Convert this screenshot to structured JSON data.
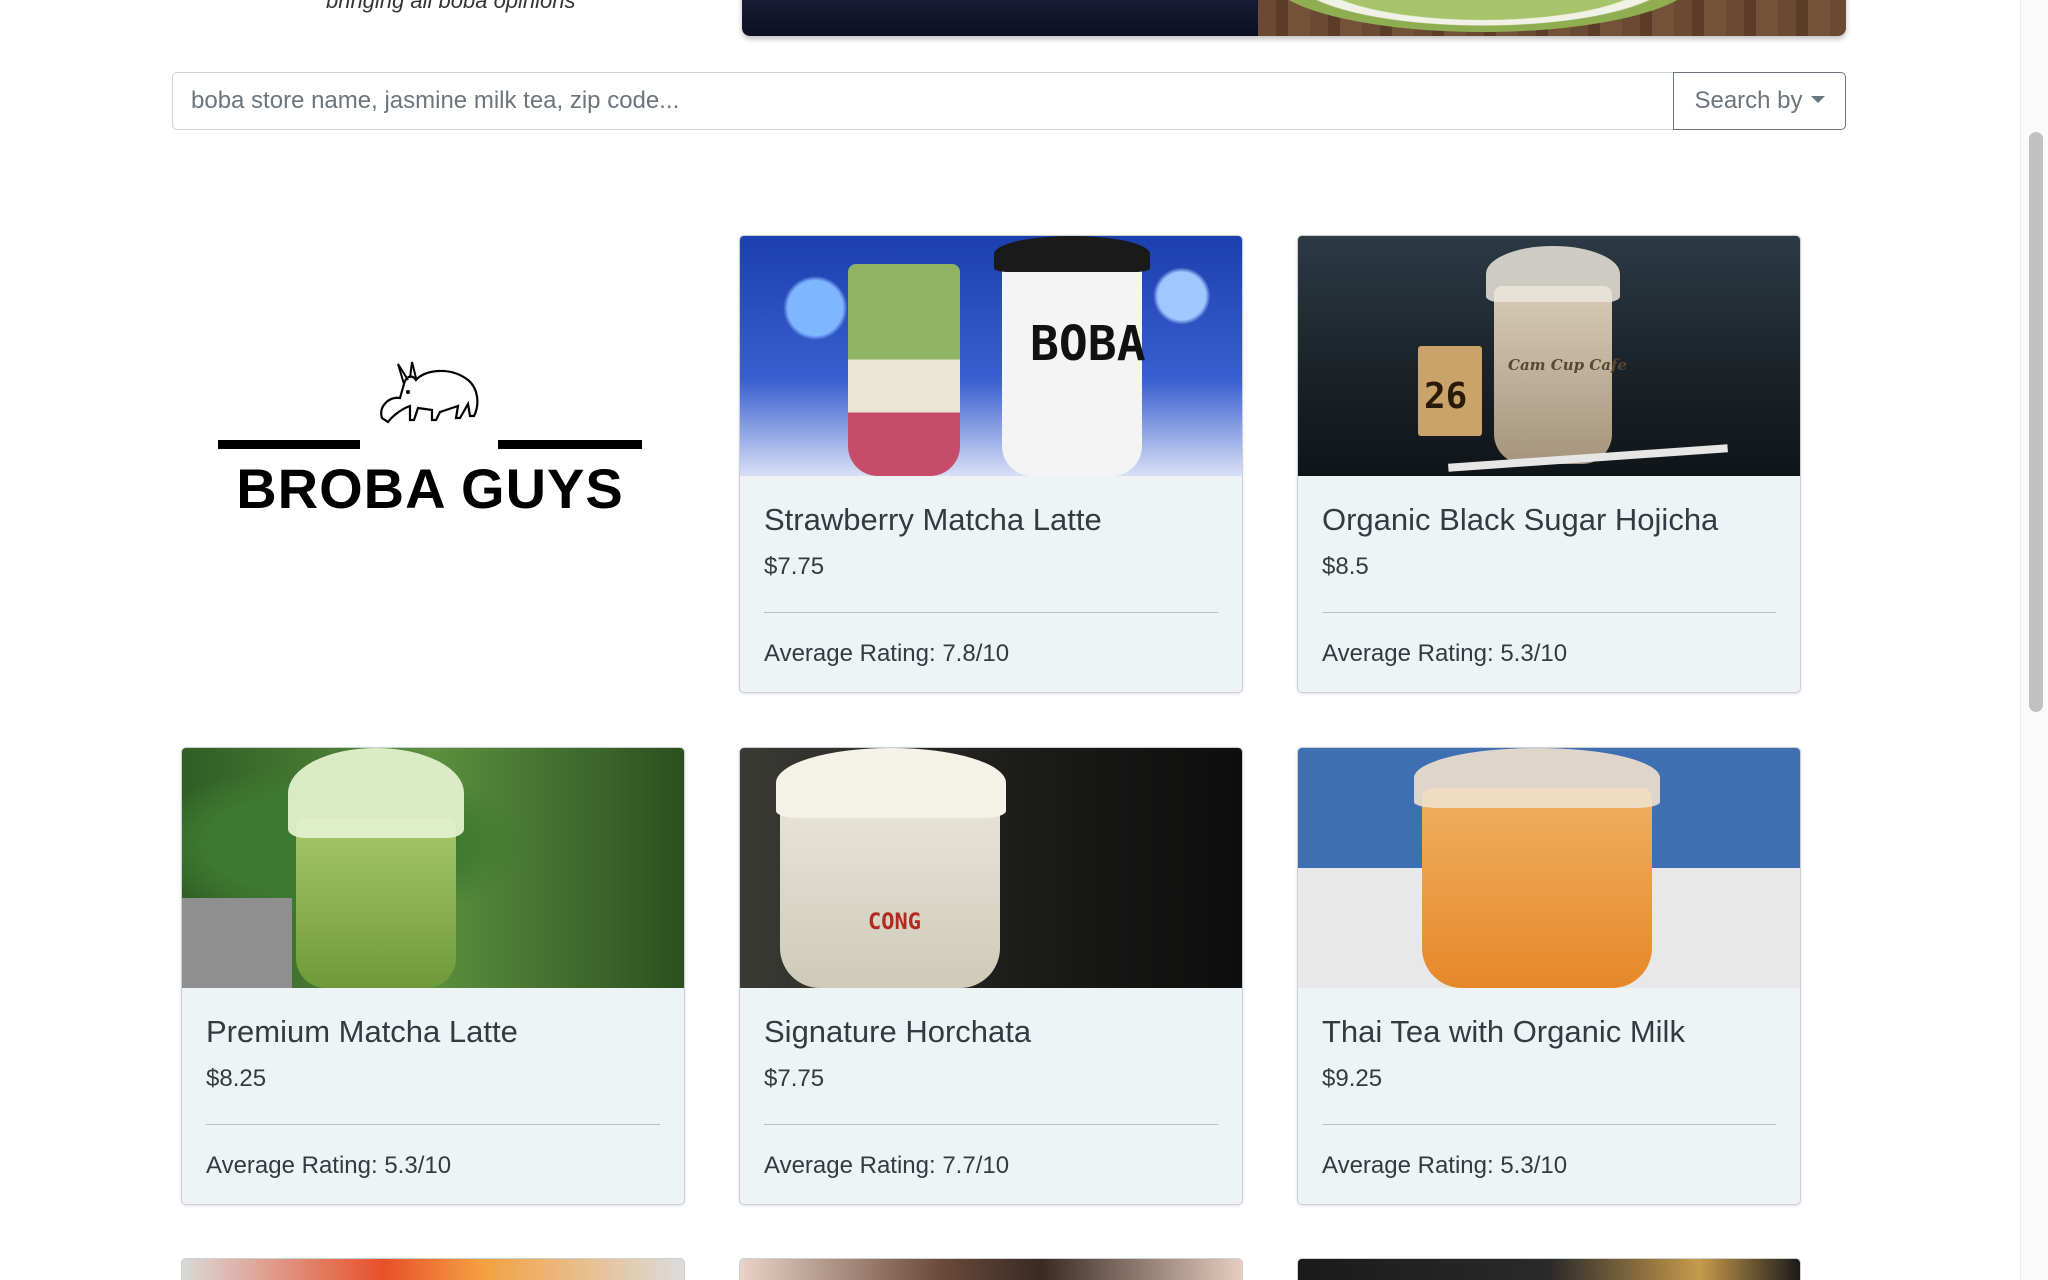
{
  "header": {
    "tagline": "bringing all boba opinions"
  },
  "search": {
    "placeholder": "boba store name, jasmine milk tea, zip code...",
    "button_label": "Search by"
  },
  "store": {
    "logo_text": "BROBA GUYS"
  },
  "drinks": [
    {
      "name": "Strawberry Matcha Latte",
      "price": "$7.75",
      "rating": "Average Rating: 7.8/10",
      "cup_text": "BOBA"
    },
    {
      "name": "Organic Black Sugar Hojicha",
      "price": "$8.5",
      "rating": "Average Rating: 5.3/10",
      "cup_text": "Cam Cup Cafe",
      "table_number": "26"
    },
    {
      "name": "Premium Matcha Latte",
      "price": "$8.25",
      "rating": "Average Rating: 5.3/10"
    },
    {
      "name": "Signature Horchata",
      "price": "$7.75",
      "rating": "Average Rating: 7.7/10",
      "cup_text": "CONG"
    },
    {
      "name": "Thai Tea with Organic Milk",
      "price": "$9.25",
      "rating": "Average Rating: 5.3/10"
    }
  ],
  "colors": {
    "card_bg": "#eef4f5",
    "text": "#343a40",
    "button_border": "#6c757d"
  }
}
